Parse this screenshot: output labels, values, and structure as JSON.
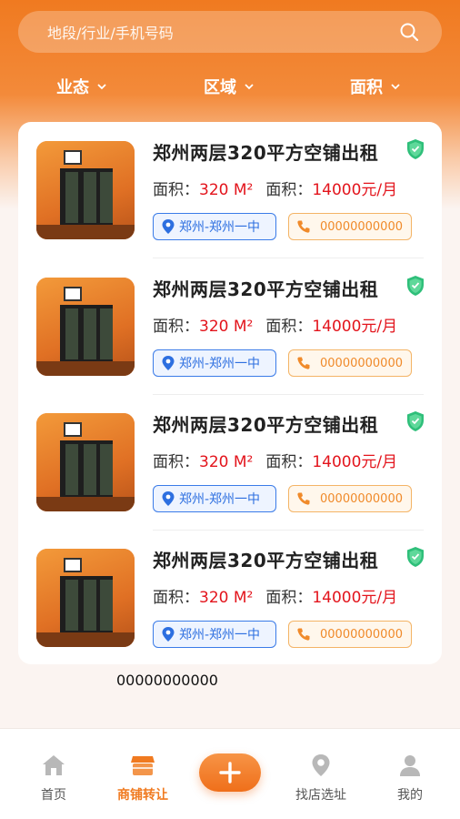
{
  "search": {
    "placeholder": "地段/行业/手机号码"
  },
  "filters": [
    {
      "label": "业态"
    },
    {
      "label": "区域"
    },
    {
      "label": "面积"
    }
  ],
  "listings": [
    {
      "title": "郑州两层320平方空铺出租",
      "area_label": "面积：",
      "area_value": "320 M²",
      "rent_label": "面积：",
      "rent_value": "14000元/月",
      "location": "郑州-郑州一中",
      "phone": "00000000000"
    },
    {
      "title": "郑州两层320平方空铺出租",
      "area_label": "面积：",
      "area_value": "320 M²",
      "rent_label": "面积：",
      "rent_value": "14000元/月",
      "location": "郑州-郑州一中",
      "phone": "00000000000"
    },
    {
      "title": "郑州两层320平方空铺出租",
      "area_label": "面积：",
      "area_value": "320 M²",
      "rent_label": "面积：",
      "rent_value": "14000元/月",
      "location": "郑州-郑州一中",
      "phone": "00000000000"
    },
    {
      "title": "郑州两层320平方空铺出租",
      "area_label": "面积：",
      "area_value": "320 M²",
      "rent_label": "面积：",
      "rent_value": "14000元/月",
      "location": "郑州-郑州一中",
      "phone": "00000000000"
    }
  ],
  "footer_note": "00000000000",
  "tabbar": {
    "home": "首页",
    "shop_transfer": "商铺转让",
    "find_shop": "找店选址",
    "mine": "我的"
  },
  "colors": {
    "accent": "#f07a20",
    "price": "#e3141c",
    "location": "#2d6fe0",
    "verified": "#2fbf7a"
  },
  "icons": {
    "search": "search-icon",
    "filter": "chevron-down-icon",
    "verified": "shield-check-icon",
    "location": "location-pin-icon",
    "phone": "phone-icon",
    "add": "plus-icon"
  }
}
